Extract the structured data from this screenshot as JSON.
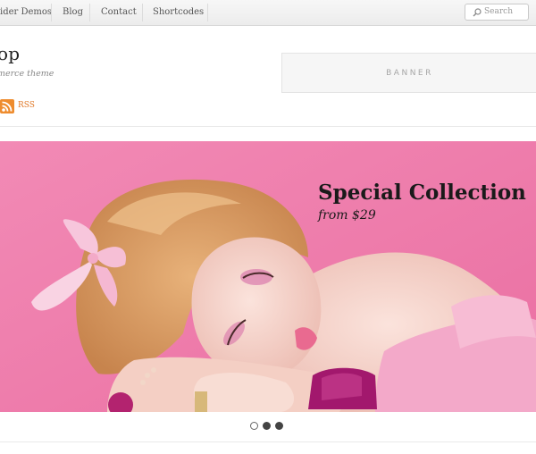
{
  "nav": {
    "items": [
      {
        "label": "ider Demos"
      },
      {
        "label": "Blog"
      },
      {
        "label": "Contact"
      },
      {
        "label": "Shortcodes"
      }
    ],
    "search_placeholder": "Search"
  },
  "header": {
    "title": "op",
    "tagline": "merce theme",
    "rss_label": "RSS",
    "banner_label": "BANNER"
  },
  "slider": {
    "title": "Special Collection",
    "subtitle": "from $29",
    "slide_count": 3,
    "active_slide": 1
  },
  "colors": {
    "slide_background": "#f07fae",
    "rss_orange": "#ee8c2e"
  },
  "icons": {
    "search": "magnifier-icon",
    "rss": "rss-feed-icon"
  }
}
